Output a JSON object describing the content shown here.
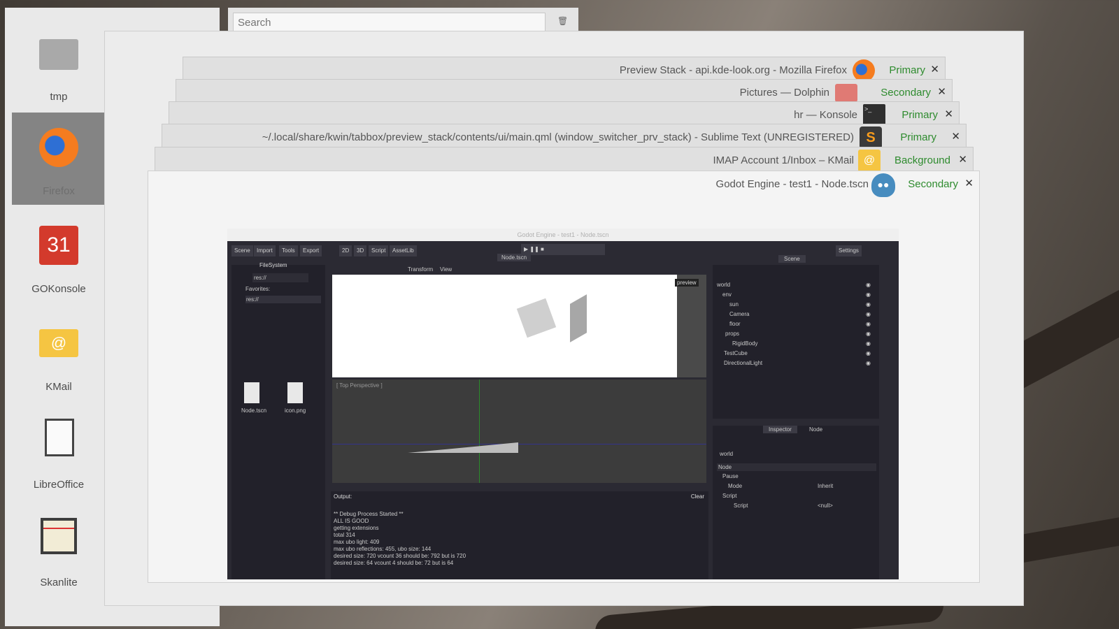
{
  "search": {
    "placeholder": "Search"
  },
  "dock": {
    "items": [
      {
        "label": "tmp"
      },
      {
        "label": "Firefox"
      },
      {
        "label": "GOKonsole",
        "calendar_day": "31"
      },
      {
        "label": "KMail"
      },
      {
        "label": "LibreOffice"
      },
      {
        "label": "Skanlite"
      }
    ]
  },
  "tabs": [
    {
      "title": "Preview Stack - api.kde-look.org - Mozilla Firefox",
      "activity": "Primary",
      "icon": "firefox-icon"
    },
    {
      "title": "Pictures — Dolphin",
      "activity": "Secondary",
      "icon": "folder-icon"
    },
    {
      "title": "hr — Konsole",
      "activity": "Primary",
      "icon": "terminal-icon"
    },
    {
      "title": "~/.local/share/kwin/tabbox/preview_stack/contents/ui/main.qml (window_switcher_prv_stack) - Sublime Text (UNREGISTERED)",
      "activity": "Primary",
      "icon": "sublime-icon"
    },
    {
      "title": "IMAP Account 1/Inbox – KMail",
      "activity": "Background",
      "icon": "mail-icon"
    },
    {
      "title": "Godot Engine - test1 - Node.tscn",
      "activity": "Secondary",
      "icon": "godot-icon"
    }
  ],
  "close_glyph": "✕",
  "godot": {
    "title": "Godot Engine - test1 - Node.tscn",
    "menu": [
      "Scene",
      "Import",
      "Tools",
      "Export"
    ],
    "modes": [
      "2D",
      "3D",
      "Script",
      "AssetLib"
    ],
    "settings": "Settings",
    "filesystem_tab": "FileSystem",
    "path": "res://",
    "favorites": "Favorites:",
    "res_item": "res://",
    "files": [
      "Node.tscn",
      "icon.png"
    ],
    "scene_tab": "Node.tscn",
    "toolbar": [
      "Transform",
      "View"
    ],
    "preview_label": "preview",
    "viewport_label": "[ Top Perspective ]",
    "scene_dock_tab": "Scene",
    "tree": [
      "world",
      "env",
      "sun",
      "Camera",
      "floor",
      "props",
      "RigidBody",
      "TestCube",
      "DirectionalLight"
    ],
    "inspector_tabs": [
      "Inspector",
      "Node"
    ],
    "inspector_object": "world",
    "inspector_rows": {
      "node": "Node",
      "pause": "Pause",
      "mode": "Mode",
      "mode_val": "Inherit",
      "script_sec": "Script",
      "script": "Script",
      "script_val": "<null>"
    },
    "output_label": "Output:",
    "clear_label": "Clear",
    "output_lines": [
      "** Debug Process Started **",
      "ALL IS GOOD",
      "getting extensions",
      "total 314",
      "max ubo light: 409",
      "max ubo reflections: 455, ubo size: 144",
      "desired size: 720 vcount 36 should be: 792 but is 720",
      "desired size: 64 vcount 4 should be: 72 but is 64"
    ]
  },
  "colors": {
    "accent_green": "#2e8b2e",
    "firefox_orange": "#f57c1f",
    "godot_blue": "#478cbf"
  }
}
